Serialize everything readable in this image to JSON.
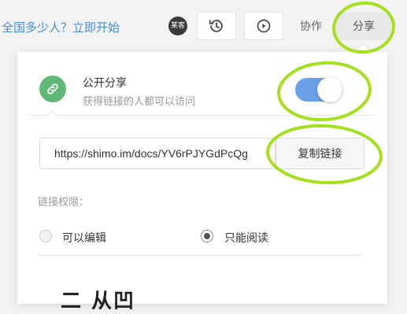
{
  "toolbar": {
    "promo_text": "全国多少人？立即开始",
    "avatar_text": "某客",
    "collab_label": "协作",
    "share_label": "分享"
  },
  "share_panel": {
    "public_title": "公开分享",
    "public_desc": "获得链接的人都可以访问",
    "public_enabled": true,
    "link_url": "https://shimo.im/docs/YV6rPJYGdPcQg",
    "copy_label": "复制链接",
    "permission_label": "链接权限：",
    "options": [
      {
        "label": "可以编辑",
        "selected": false
      },
      {
        "label": "只能阅读",
        "selected": true
      }
    ],
    "bottom_partial": "二 从凹"
  },
  "colors": {
    "accent_blue": "#6aa0e8",
    "link_green": "#5fb878",
    "annotation": "#a5e01f"
  }
}
